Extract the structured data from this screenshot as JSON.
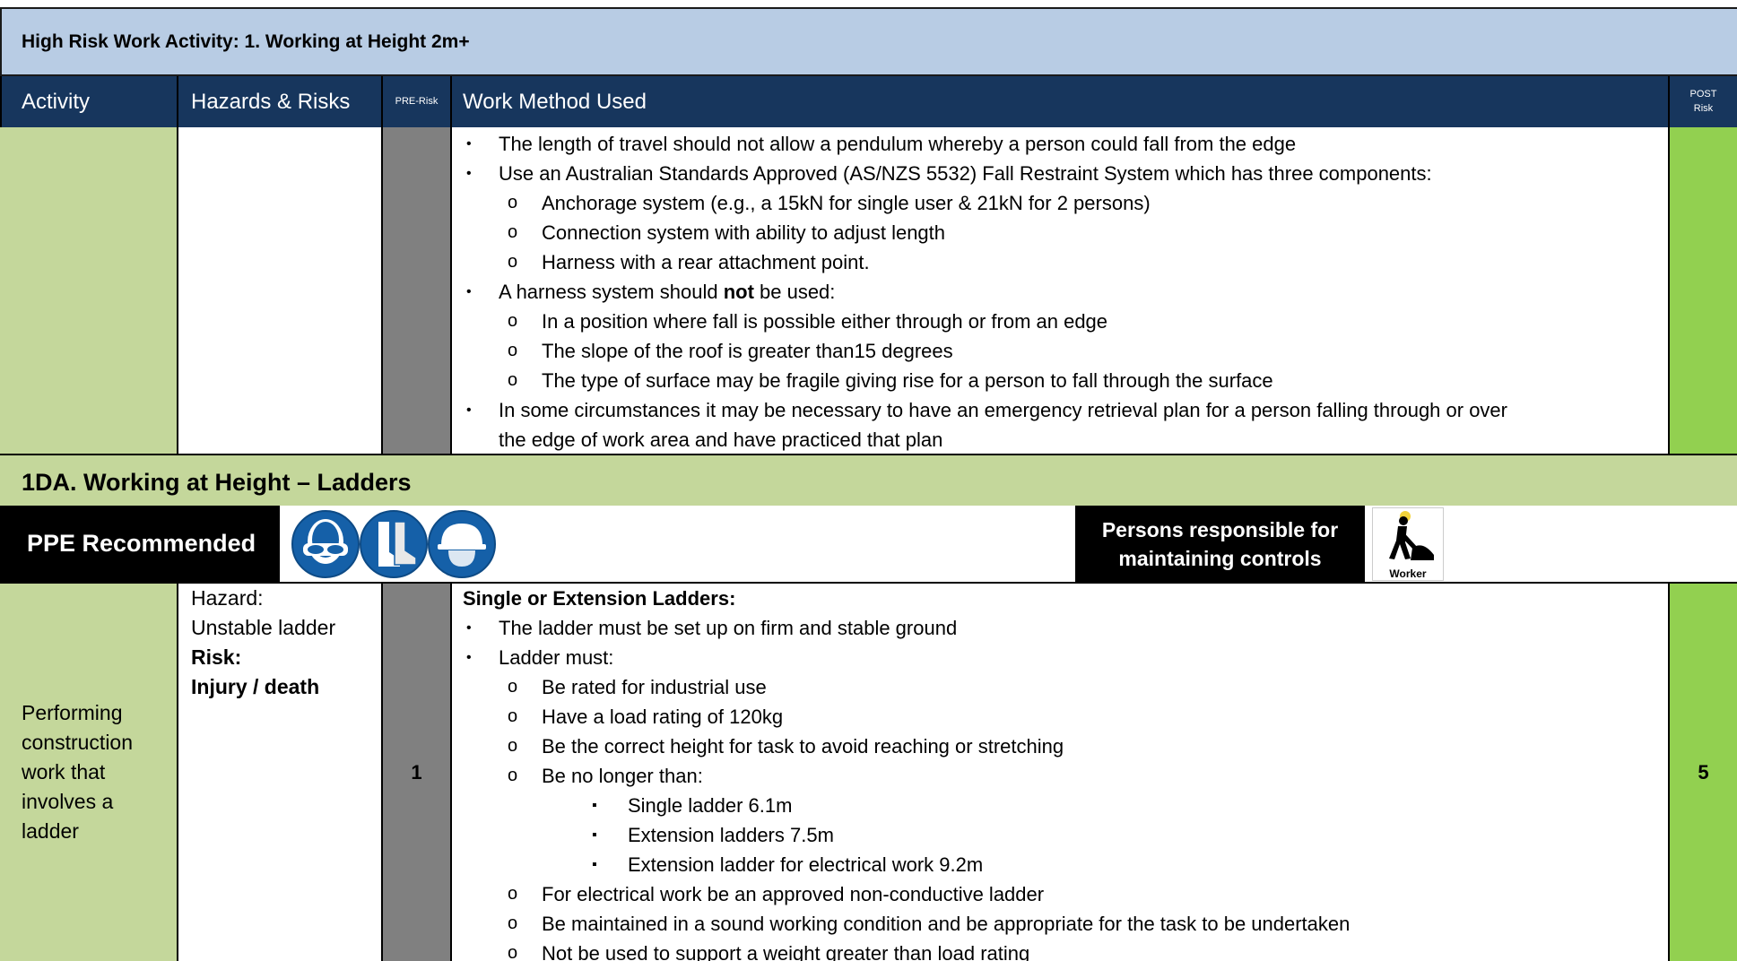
{
  "title": "High Risk Work Activity:  1. Working at Height 2m+",
  "headers": {
    "activity": "Activity",
    "hazards": "Hazards & Risks",
    "pre_risk": "PRE-Risk",
    "method": "Work Method Used",
    "post_risk": "POST Risk"
  },
  "section1_items": [
    {
      "level": 0,
      "bullet": "•",
      "text": "The length of travel should not allow a pendulum whereby a person could fall from the edge"
    },
    {
      "level": 0,
      "bullet": "•",
      "text": "Use an Australian Standards Approved (AS/NZS 5532) Fall Restraint System which has three components:"
    },
    {
      "level": 1,
      "bullet": "o",
      "text": "Anchorage system (e.g., a 15kN for single user & 21kN for 2 persons)"
    },
    {
      "level": 1,
      "bullet": "o",
      "text": "Connection system with ability to adjust length"
    },
    {
      "level": 1,
      "bullet": "o",
      "text": "Harness with a rear attachment point."
    },
    {
      "level": 0,
      "bullet": "•",
      "pre": "A harness system should ",
      "bold": "not",
      "post": " be used:"
    },
    {
      "level": 1,
      "bullet": "o",
      "text": "In a position where fall is possible either through or from an edge"
    },
    {
      "level": 1,
      "bullet": "o",
      "text": "The slope of the roof is greater than15 degrees"
    },
    {
      "level": 1,
      "bullet": "o",
      "text": "The type of surface may be fragile giving rise for a person to fall through the surface"
    },
    {
      "level": 0,
      "bullet": "•",
      "text": "In some circumstances it may be necessary to have an emergency retrieval plan for a person falling through or over"
    },
    {
      "level": "cont",
      "bullet": "",
      "text": "the edge of work area and have practiced that plan"
    }
  ],
  "section2": {
    "heading": "1DA. Working at Height – Ladders",
    "ppe_label": "PPE Recommended",
    "ppe_icons": [
      "safety-glasses-icon",
      "safety-boots-icon",
      "hard-hat-icon"
    ],
    "responsible_label": "Persons responsible for maintaining controls",
    "worker_label": "Worker",
    "activity": "Performing construction work that involves a ladder",
    "hazard_label": "Hazard:",
    "hazard_text": "Unstable ladder",
    "risk_label": "Risk:",
    "risk_text": "Injury / death",
    "pre_risk": "1",
    "post_risk": "5",
    "method_heading": "Single or Extension Ladders:",
    "items": [
      {
        "level": 0,
        "bullet": "•",
        "text": "The ladder must be set up on firm and stable ground"
      },
      {
        "level": 0,
        "bullet": "•",
        "text": "Ladder must:"
      },
      {
        "level": 1,
        "bullet": "o",
        "text": "Be rated for industrial use"
      },
      {
        "level": 1,
        "bullet": "o",
        "text": "Have a load rating of 120kg"
      },
      {
        "level": 1,
        "bullet": "o",
        "text": "Be the correct height for task to avoid reaching or stretching"
      },
      {
        "level": 1,
        "bullet": "o",
        "text": "Be no longer than:"
      },
      {
        "level": 2,
        "bullet": "▪",
        "text": "Single ladder 6.1m"
      },
      {
        "level": 2,
        "bullet": "▪",
        "text": "Extension ladders 7.5m"
      },
      {
        "level": 2,
        "bullet": "▪",
        "text": "Extension ladder for electrical work 9.2m"
      },
      {
        "level": 1,
        "bullet": "o",
        "text": "For electrical work be an approved non-conductive ladder"
      },
      {
        "level": 1,
        "bullet": "o",
        "text": "Be maintained in a sound working condition and be appropriate for the task to be undertaken"
      },
      {
        "level": 1,
        "bullet": "o",
        "text": "Not be used to support a weight greater than load rating"
      }
    ]
  }
}
